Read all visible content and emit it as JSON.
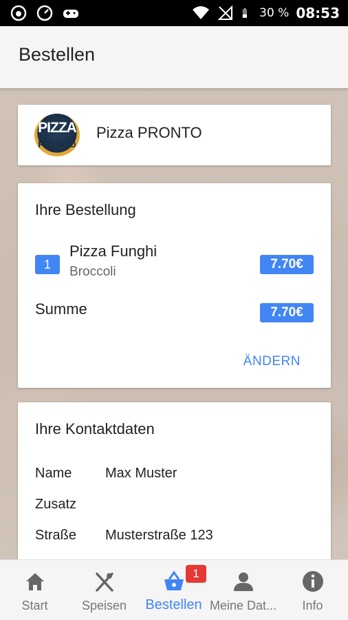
{
  "statusbar": {
    "battery": "30 %",
    "time": "08:53"
  },
  "appbar": {
    "title": "Bestellen"
  },
  "restaurant": {
    "logo_top": "PIZZA",
    "logo_bottom": "PRONTO",
    "name": "Pizza PRONTO"
  },
  "order": {
    "title": "Ihre Bestellung",
    "items": [
      {
        "qty": "1",
        "name": "Pizza Funghi",
        "extra": "Broccoli",
        "price": "7.70€"
      }
    ],
    "sum_label": "Summe",
    "sum_price": "7.70€",
    "change_label": "ÄNDERN"
  },
  "contact": {
    "title": "Ihre Kontaktdaten",
    "rows": [
      {
        "label": "Name",
        "value": "Max Muster"
      },
      {
        "label": "Zusatz",
        "value": ""
      },
      {
        "label": "Straße",
        "value": "Musterstraße 123"
      }
    ]
  },
  "nav": {
    "items": [
      {
        "label": "Start",
        "icon": "home-icon"
      },
      {
        "label": "Speisen",
        "icon": "cutlery-icon"
      },
      {
        "label": "Bestellen",
        "icon": "basket-icon"
      },
      {
        "label": "Meine Dat...",
        "icon": "person-icon"
      },
      {
        "label": "Info",
        "icon": "info-icon"
      }
    ],
    "cart_count": "1"
  },
  "colors": {
    "accent": "#4285f4",
    "badge": "#e53935"
  }
}
